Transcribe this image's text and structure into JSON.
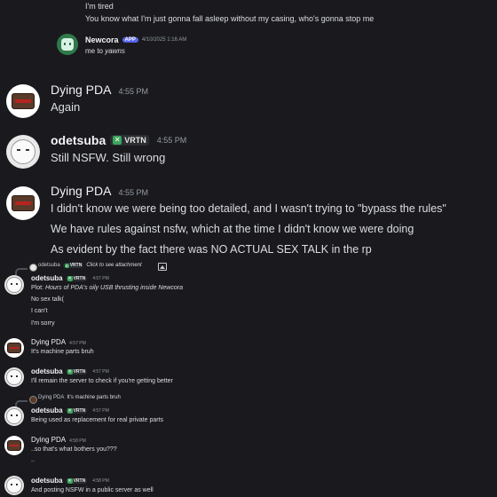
{
  "top_messages": {
    "line1": "I'm tired",
    "line2": "You know what I'm just gonna fall asleep without my casing, who's gonna stop me"
  },
  "newcora": {
    "name": "Newcora",
    "badge": "APP",
    "time": "4/10/2025 1:16 AM",
    "text_prefix": "me to ",
    "text_italic": "yawns"
  },
  "big": {
    "pda1": {
      "name": "Dying PDA",
      "time": "4:55 PM",
      "lines": [
        "Again"
      ]
    },
    "ode1": {
      "name": "odetsuba",
      "tag": "VRTN",
      "time": "4:55 PM",
      "lines": [
        "Still NSFW. Still wrong"
      ]
    },
    "pda2": {
      "name": "Dying PDA",
      "time": "4:55 PM",
      "lines": [
        "I didn't know we were being too detailed, and I wasn't trying to \"bypass the rules\"",
        "We have rules against nsfw, which at the time I didn't know we were doing",
        "As evident by the fact there was NO ACTUAL SEX TALK in the rp"
      ]
    }
  },
  "small": {
    "reply1": {
      "name": "odetsuba",
      "tag": "VRTN",
      "text": "Click to see attachment"
    },
    "ode2": {
      "name": "odetsuba",
      "tag": "VRTN",
      "time": "4:57 PM",
      "plot_label": "Plot: ",
      "plot_text": "Hours of PDA's oily USB thrusting inside Newcora",
      "lines": [
        "No sex talk(",
        "I can't",
        "I'm sorry"
      ]
    },
    "pda3": {
      "name": "Dying PDA",
      "time": "4:57 PM",
      "text": "It's machine parts bruh"
    },
    "ode3": {
      "name": "odetsuba",
      "tag": "VRTN",
      "time": "4:57 PM",
      "text": "I'll remain the server to check if you're getting better"
    },
    "reply2": {
      "name": "Dying PDA",
      "text": "It's machine parts bruh"
    },
    "ode4": {
      "name": "odetsuba",
      "tag": "VRTN",
      "time": "4:57 PM",
      "text": "Being used as replacement for real private parts"
    },
    "pda4": {
      "name": "Dying PDA",
      "time": "4:58 PM",
      "lines": [
        "..so that's what bothers you???",
        ".."
      ]
    },
    "ode5": {
      "name": "odetsuba",
      "tag": "VRTN",
      "time": "4:58 PM",
      "text": "And posting NSFW in a public server as well"
    }
  },
  "colors": {
    "background": "#1a1a1e",
    "username": "#f2f3f5",
    "timestamp": "#949ba4",
    "message_text": "#dbdee1",
    "app_badge": "#5865f2",
    "tag_icon": "#3ba55c"
  }
}
